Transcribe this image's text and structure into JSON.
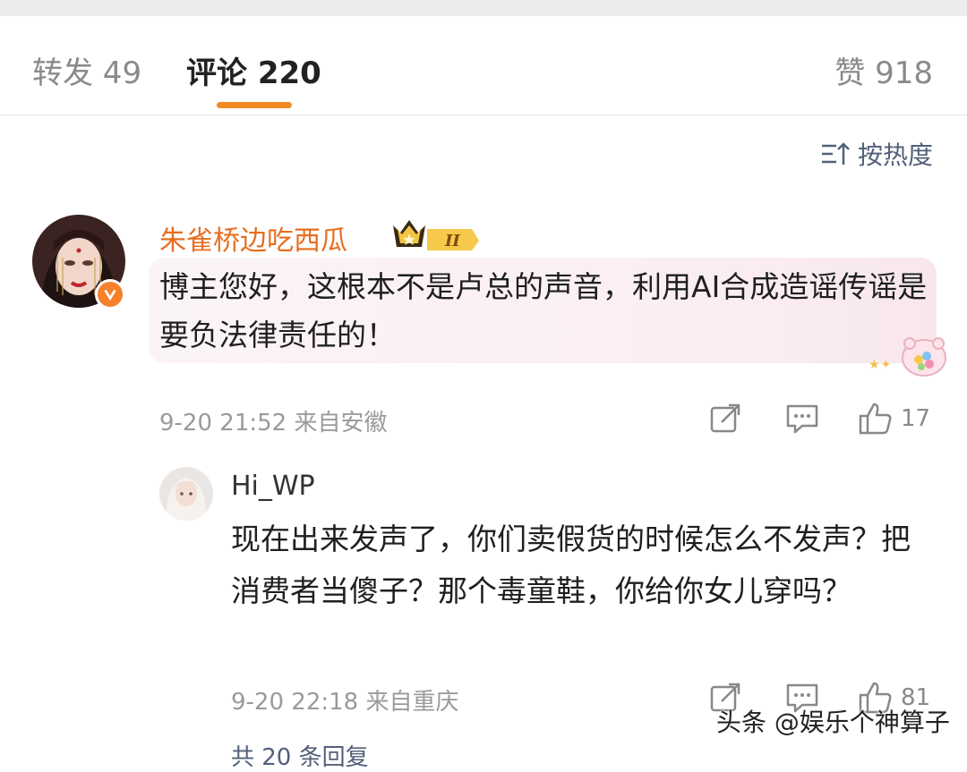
{
  "tabs": {
    "repost": "转发 49",
    "comment": "评论 220",
    "like": "赞 918"
  },
  "sort": {
    "label": "按热度",
    "icon": "sort-icon"
  },
  "comment": {
    "username": "朱雀桥边吃西瓜",
    "level_badge": "II",
    "text": "博主您好，这根本不是卢总的声音，利用AI合成造谣传谣是要负法律责任的！",
    "meta": "9-20 21:52 来自安徽",
    "likes": "17"
  },
  "reply": {
    "username": "Hi_WP",
    "text": "现在出来发声了，你们卖假货的时候怎么不发声？把消费者当傻子？那个毒童鞋，你给你女儿穿吗？",
    "meta": "9-20 22:18 来自重庆",
    "likes": "81"
  },
  "more_replies": "共 20 条回复",
  "watermark": "头条 @娱乐个神算子",
  "colors": {
    "accent": "#f08a24",
    "username": "#e86d1f",
    "link": "#52607a"
  }
}
